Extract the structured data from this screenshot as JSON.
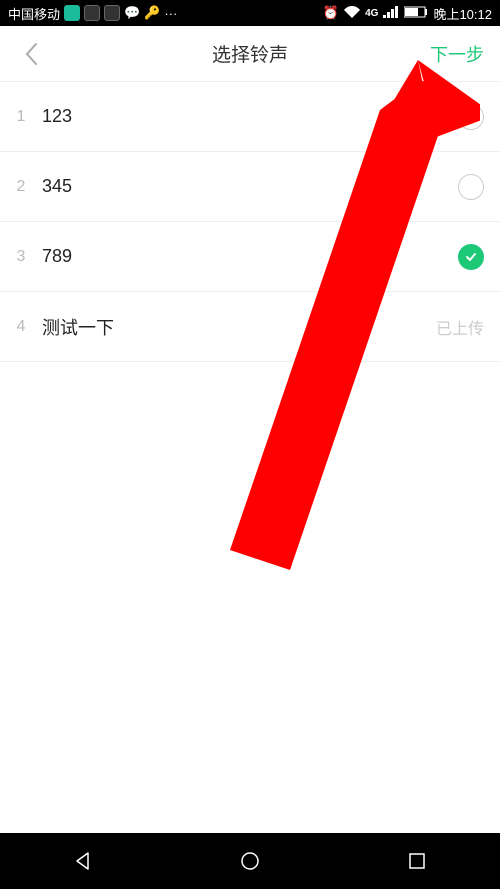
{
  "status_bar": {
    "carrier": "中国移动",
    "network": "4G",
    "time": "晚上10:12"
  },
  "header": {
    "title": "选择铃声",
    "next_label": "下一步"
  },
  "list": {
    "items": [
      {
        "index": "1",
        "label": "123",
        "selected": false,
        "status": null
      },
      {
        "index": "2",
        "label": "345",
        "selected": false,
        "status": null
      },
      {
        "index": "3",
        "label": "789",
        "selected": true,
        "status": null
      },
      {
        "index": "4",
        "label": "测试一下",
        "selected": false,
        "status": "已上传"
      }
    ]
  },
  "colors": {
    "accent": "#1dc877",
    "arrow": "#ff0000"
  }
}
